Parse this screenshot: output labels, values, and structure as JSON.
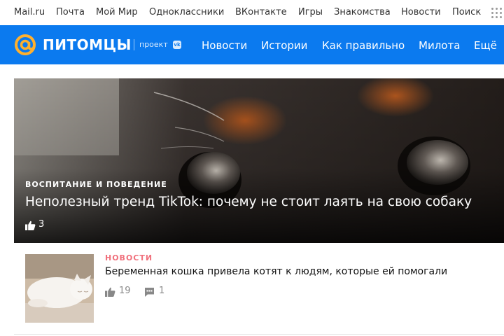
{
  "portal_nav": [
    "Mail.ru",
    "Почта",
    "Мой Мир",
    "Одноклассники",
    "ВКонтакте",
    "Игры",
    "Знакомства",
    "Новости",
    "Поиск"
  ],
  "brand": {
    "logo_text": "ПИТОМЦЫ",
    "project_label": "проект",
    "vk_badge": "vk",
    "color": "#0b7aef"
  },
  "main_nav": [
    "Новости",
    "Истории",
    "Как правильно",
    "Милота",
    "Ещё"
  ],
  "hero": {
    "category": "ВОСПИТАНИЕ И ПОВЕДЕНИЕ",
    "title": "Неполезный тренд TikTok: почему не стоит лаять на свою собаку",
    "likes": "3"
  },
  "article": {
    "category": "НОВОСТИ",
    "category_color": "#f0707c",
    "title": "Беременная кошка привела котят к людям, которые ей помогали",
    "likes": "19",
    "comments": "1"
  }
}
